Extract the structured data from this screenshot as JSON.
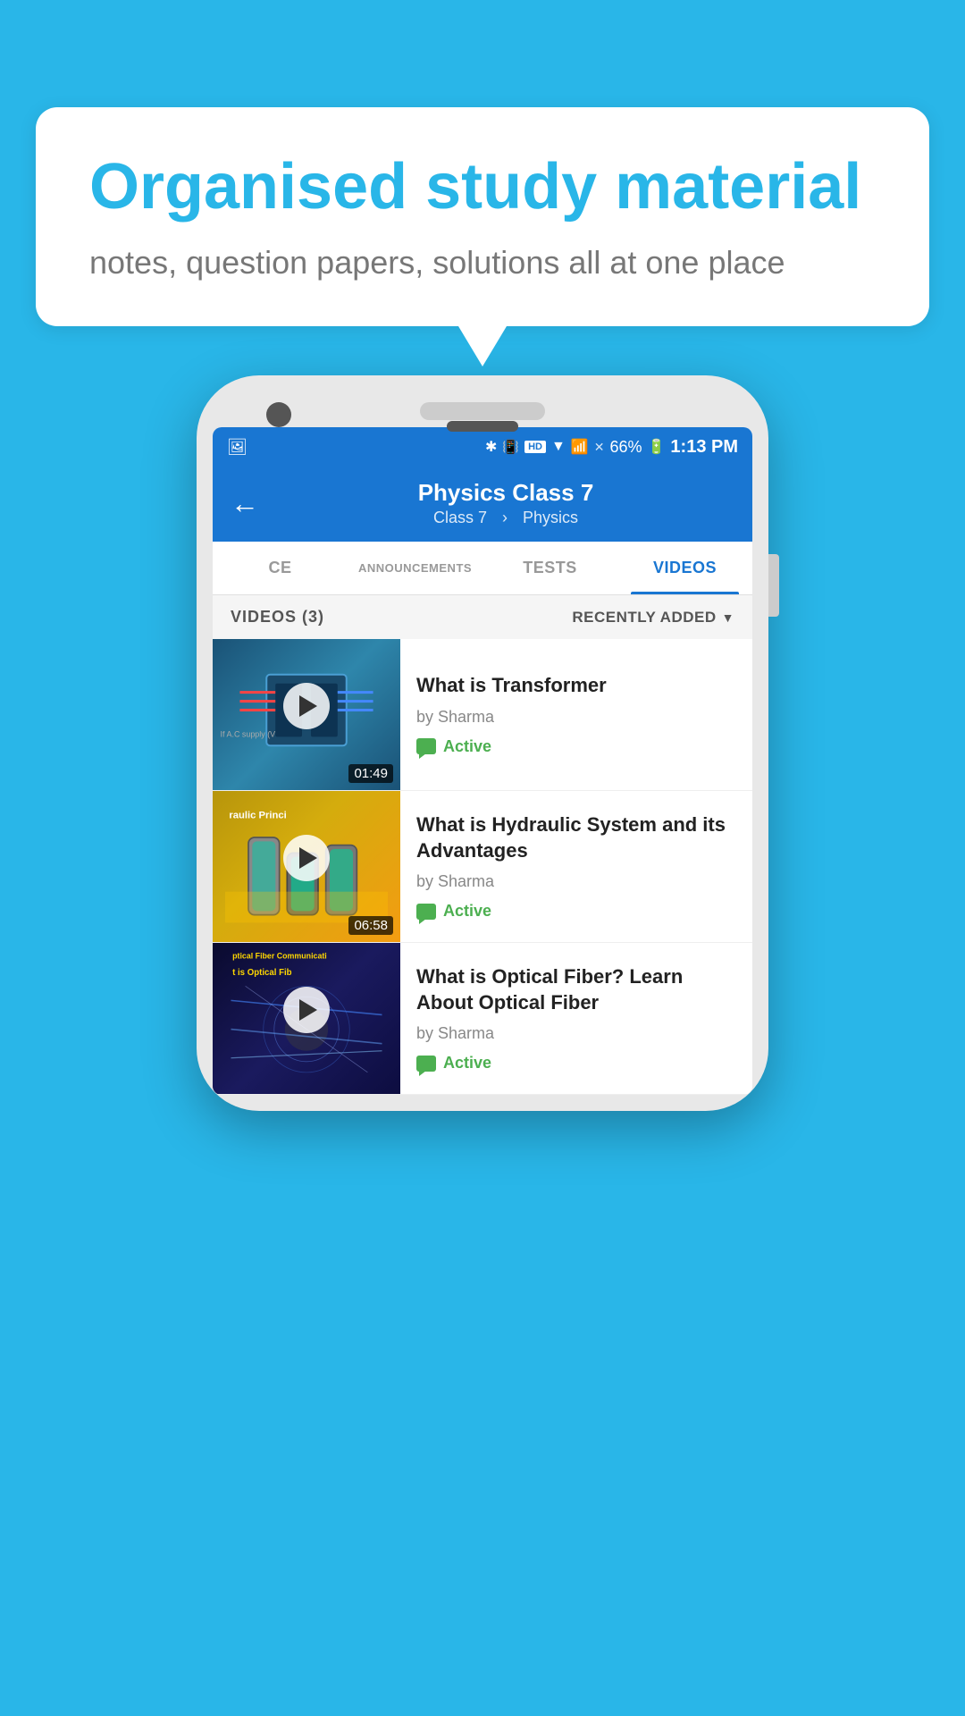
{
  "background_color": "#29b6e8",
  "speech_bubble": {
    "title": "Organised study material",
    "subtitle": "notes, question papers, solutions all at one place"
  },
  "phone": {
    "status_bar": {
      "battery_pct": "66%",
      "time": "1:13 PM",
      "hd_label": "HD"
    },
    "nav": {
      "back_label": "←",
      "title": "Physics Class 7",
      "breadcrumb_class": "Class 7",
      "breadcrumb_sep": "›",
      "breadcrumb_subject": "Physics"
    },
    "tabs": [
      {
        "label": "CE",
        "active": false
      },
      {
        "label": "ANNOUNCEMENTS",
        "active": false
      },
      {
        "label": "TESTS",
        "active": false
      },
      {
        "label": "VIDEOS",
        "active": true
      }
    ],
    "filter_bar": {
      "count_label": "VIDEOS (3)",
      "sort_label": "RECENTLY ADDED"
    },
    "videos": [
      {
        "title": "What is  Transformer",
        "author": "by Sharma",
        "status": "Active",
        "duration": "01:49",
        "thumb_type": "transformer"
      },
      {
        "title": "What is Hydraulic System and its Advantages",
        "author": "by Sharma",
        "status": "Active",
        "duration": "06:58",
        "thumb_type": "hydraulic",
        "thumb_text": "raulic Princi"
      },
      {
        "title": "What is Optical Fiber? Learn About Optical Fiber",
        "author": "by Sharma",
        "status": "Active",
        "duration": "",
        "thumb_type": "optical",
        "thumb_text_line1": "ptical Fiber Communicati",
        "thumb_text_line2": "t is Optical Fib"
      }
    ]
  }
}
